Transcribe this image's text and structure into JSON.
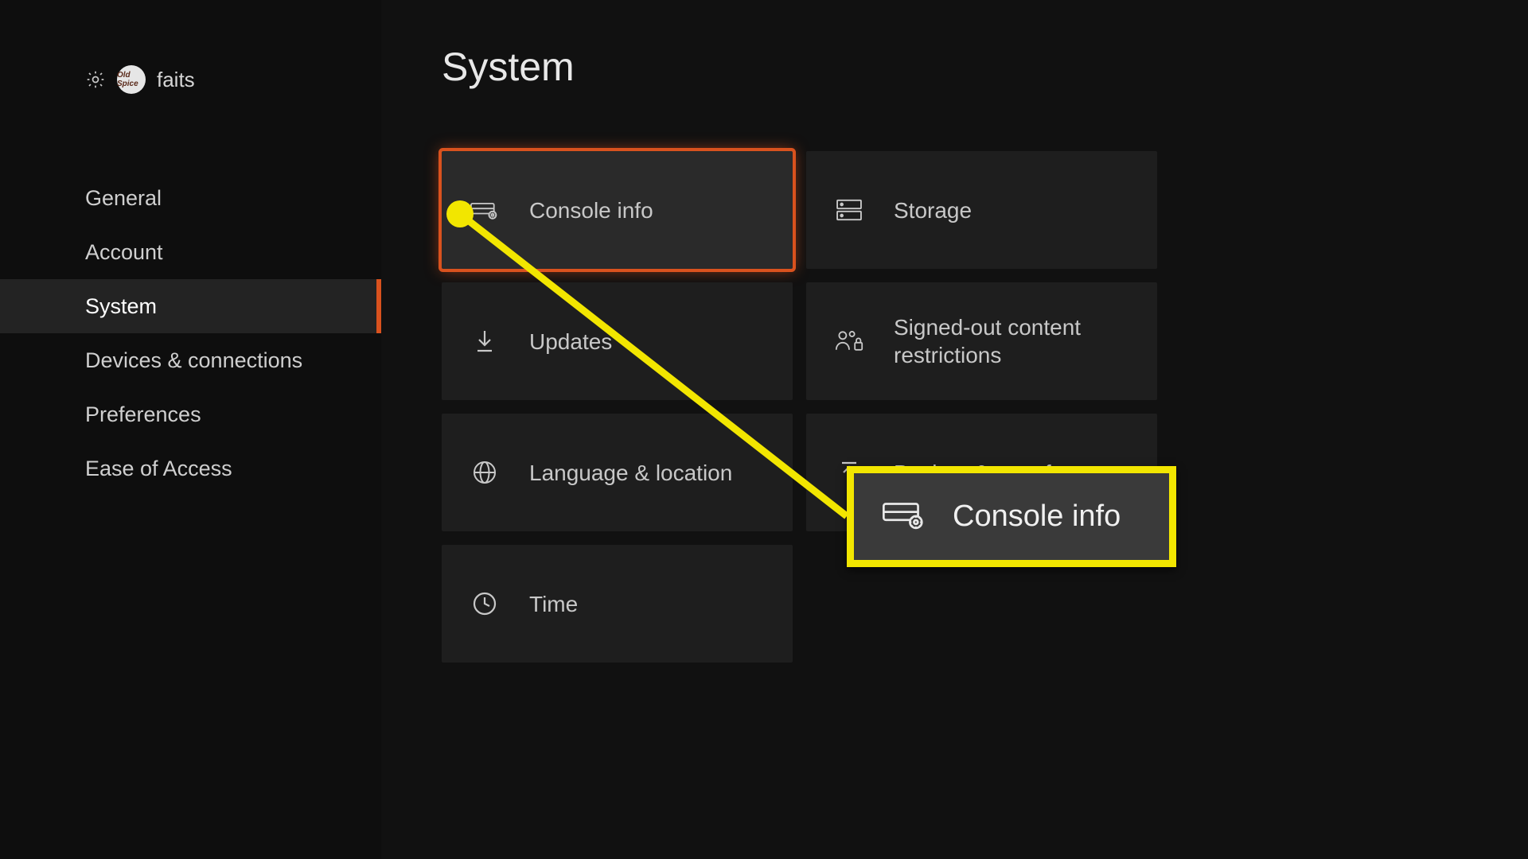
{
  "sidebar": {
    "username": "faits",
    "avatar_text": "Old Spice",
    "items": [
      {
        "label": "General"
      },
      {
        "label": "Account"
      },
      {
        "label": "System"
      },
      {
        "label": "Devices & connections"
      },
      {
        "label": "Preferences"
      },
      {
        "label": "Ease of Access"
      }
    ]
  },
  "main": {
    "title": "System",
    "tiles": [
      {
        "label": "Console info",
        "icon": "console-info"
      },
      {
        "label": "Storage",
        "icon": "storage"
      },
      {
        "label": "Updates",
        "icon": "download"
      },
      {
        "label": "Signed-out content restrictions",
        "icon": "people-lock"
      },
      {
        "label": "Language & location",
        "icon": "globe"
      },
      {
        "label": "Backup & transfer",
        "icon": "upload"
      },
      {
        "label": "Time",
        "icon": "clock"
      }
    ]
  },
  "callout": {
    "label": "Console info"
  },
  "colors": {
    "accent": "#d9521e",
    "annotation": "#f2e600"
  }
}
